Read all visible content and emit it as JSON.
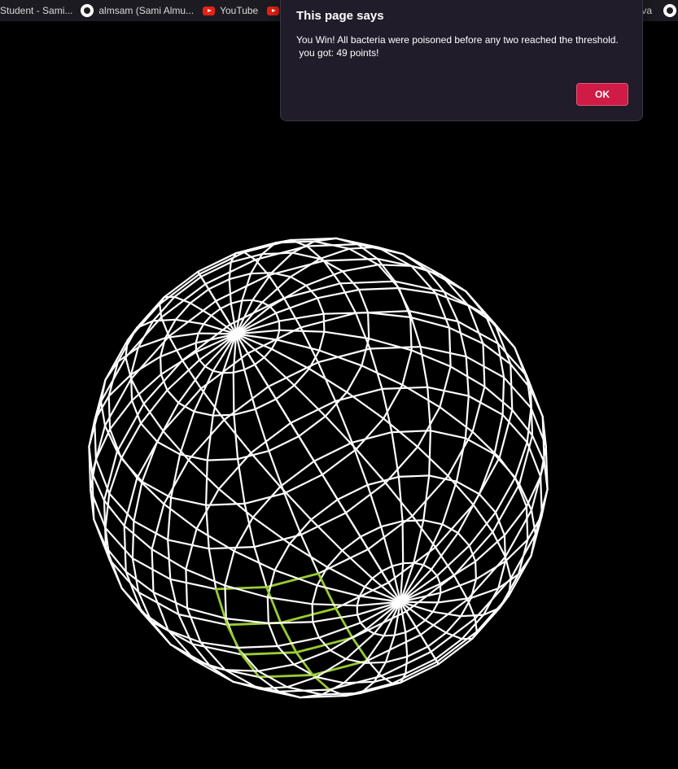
{
  "bookmarks": {
    "items": [
      {
        "label": "Student - Sami...",
        "icon": "none"
      },
      {
        "label": "almsam (Sami Almu...",
        "icon": "github-icon"
      },
      {
        "label": "YouTube",
        "icon": "youtube-icon"
      },
      {
        "label": "",
        "icon": "youtube-icon"
      }
    ],
    "right_partial_label": "va",
    "right_icon": "github-icon"
  },
  "dialog": {
    "title": "This page says",
    "message_line1": "You Win! All bacteria were poisoned before any two reached the threshold.",
    "message_line2": " you got: 49 points!",
    "ok_label": "OK"
  },
  "game": {
    "points": 49,
    "sphere_color": "#ffffff",
    "bacteria_color": "#9acd32",
    "background": "#000000"
  }
}
